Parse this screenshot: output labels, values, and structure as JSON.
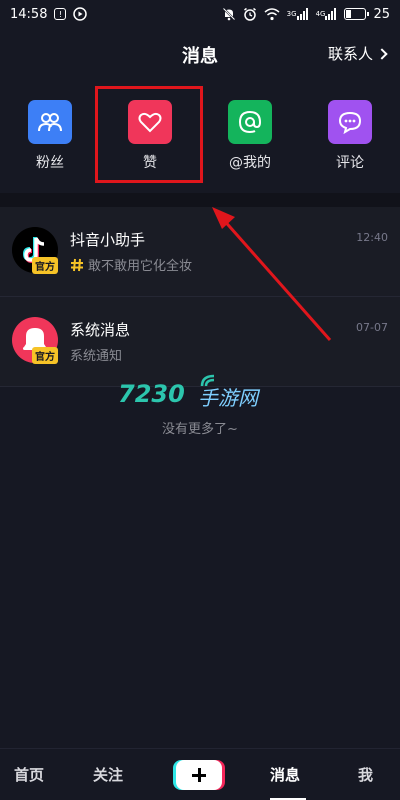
{
  "status_bar": {
    "time": "14:58",
    "notification_icons": [
      "alert-box-icon",
      "play-circle-icon"
    ],
    "right_icons": [
      "bell-off-icon",
      "alarm-icon",
      "wifi-icon",
      "signal-3g-icon",
      "signal-4g-icon"
    ],
    "signal_1_label": "3G",
    "signal_2_label": "4G",
    "battery": "25"
  },
  "header": {
    "title": "消息",
    "contacts_label": "联系人"
  },
  "categories": [
    {
      "label": "粉丝",
      "color": "#3d7ff6",
      "icon": "people-icon"
    },
    {
      "label": "赞",
      "color": "#f0365a",
      "icon": "heart-icon"
    },
    {
      "label": "@我的",
      "color": "#14b45c",
      "icon": "at-icon"
    },
    {
      "label": "评论",
      "color": "#a052f0",
      "icon": "comment-icon"
    }
  ],
  "messages": [
    {
      "title": "抖音小助手",
      "subtitle": "敢不敢用它化全妆",
      "time": "12:40",
      "badge": "官方"
    },
    {
      "title": "系统消息",
      "subtitle": "系统通知",
      "time": "07-07",
      "badge": "官方"
    }
  ],
  "watermark": {
    "number": "7230",
    "text": "手游网"
  },
  "no_more_text": "没有更多了~",
  "tabs": {
    "home": "首页",
    "follow": "关注",
    "messages": "消息",
    "me": "我"
  },
  "colors": {
    "background": "#161823",
    "highlight": "#e0161c",
    "badge": "#f6c327"
  }
}
